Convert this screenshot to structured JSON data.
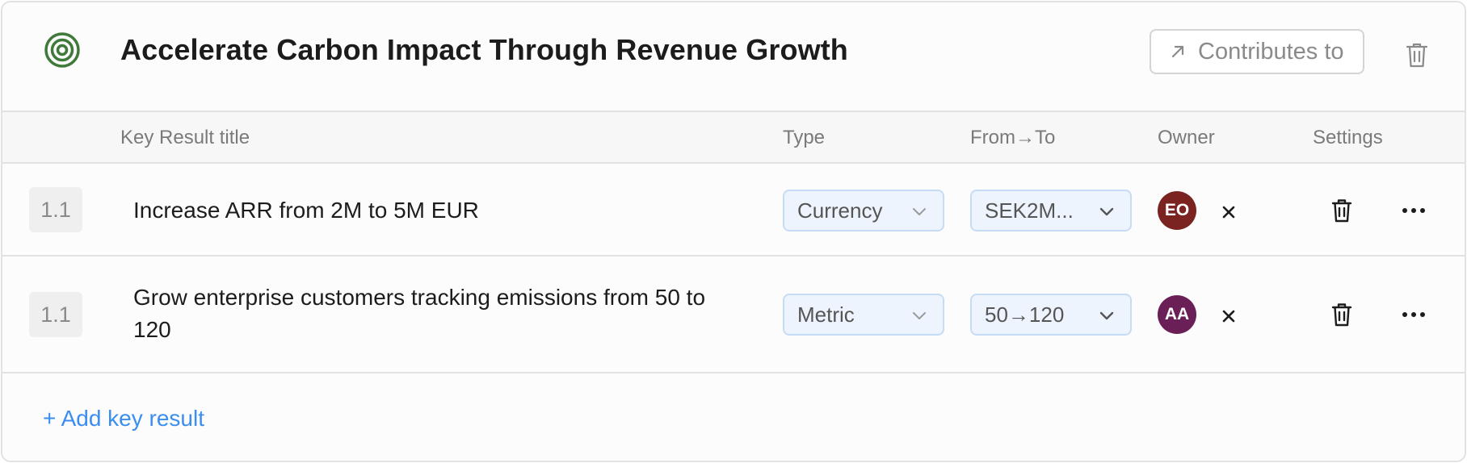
{
  "objective": {
    "title": "Accelerate Carbon Impact Through Revenue Growth",
    "contributes_label": "Contributes to",
    "icon": "target-icon",
    "icon_color": "#3f7a3a"
  },
  "table": {
    "headers": {
      "title": "Key Result title",
      "type": "Type",
      "from_to": "From→To",
      "owner": "Owner",
      "settings": "Settings"
    },
    "rows": [
      {
        "number": "1.1",
        "title": "Increase ARR from 2M to 5M EUR",
        "type": "Currency",
        "from_to": "SEK2M...",
        "owner_initials": "EO",
        "owner_color": "#7a2320"
      },
      {
        "number": "1.1",
        "title": "Grow enterprise customers tracking emissions from 50 to 120",
        "type": "Metric",
        "from_to": "50→120",
        "owner_initials": "AA",
        "owner_color": "#6a1f57"
      }
    ]
  },
  "add_key_result_label": "+ Add key result",
  "colors": {
    "accent_link": "#3b8ef0",
    "select_bg": "#eef4fd",
    "select_border": "#c6dcf5"
  }
}
